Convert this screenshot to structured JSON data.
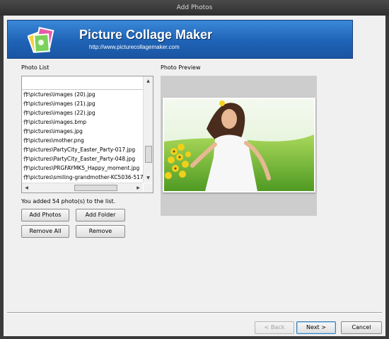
{
  "window": {
    "title": "Add Photos"
  },
  "banner": {
    "title": "Picture Collage Maker",
    "url": "http://www.picturecollagemaker.com"
  },
  "photo_list": {
    "label": "Photo List",
    "rows": [
      "作\\pictures\\images (20).jpg",
      "作\\pictures\\images (21).jpg",
      "作\\pictures\\images (22).jpg",
      "作\\pictures\\images.bmp",
      "作\\pictures\\images.jpg",
      "作\\pictures\\mother.png",
      "作\\pictures\\PartyCity_Easter_Party-017.jpg",
      "作\\pictures\\PartyCity_Easter_Party-048.jpg",
      "作\\pictures\\PRGFAYMK5_Happy_moment.jpg",
      "作\\pictures\\smiling-grandmother-KC5036-517"
    ],
    "status": "You added 54 photo(s) to the list."
  },
  "preview": {
    "label": "Photo Preview"
  },
  "buttons": {
    "add_photos": "Add Photos",
    "add_folder": "Add Folder",
    "remove_all": "Remove All",
    "remove": "Remove",
    "back": "< Back",
    "next": "Next >",
    "cancel": "Cancel"
  },
  "icons": {
    "scroll_up": "scroll-up-arrow-icon",
    "scroll_down": "scroll-down-arrow-icon",
    "scroll_left": "scroll-left-arrow-icon",
    "scroll_right": "scroll-right-arrow-icon",
    "logo": "photo-stack-logo-icon"
  },
  "colors": {
    "banner": "#1f63b6",
    "titlebar": "#3a3a3a",
    "preview_bg": "#cdcdcd"
  }
}
